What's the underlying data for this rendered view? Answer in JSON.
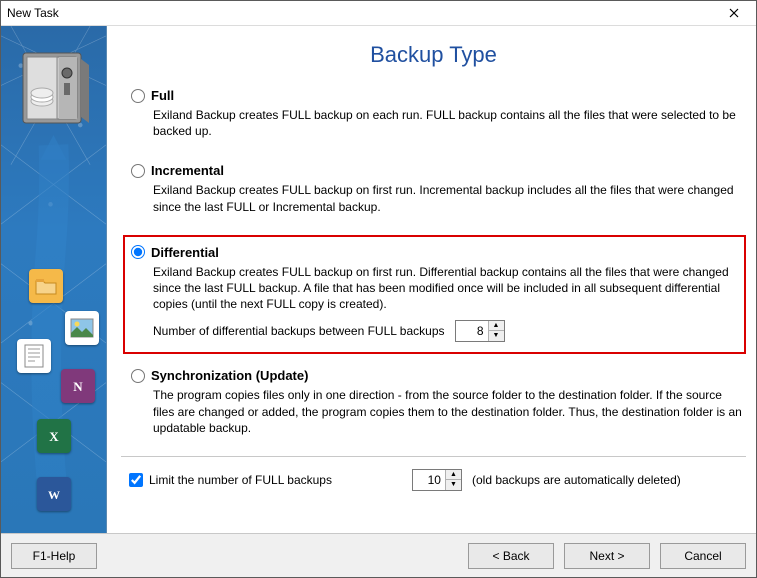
{
  "window": {
    "title": "New Task"
  },
  "heading": "Backup Type",
  "options": {
    "full": {
      "label": "Full",
      "desc": "Exiland Backup creates FULL backup on each run. FULL backup contains all the files that were selected to be backed up."
    },
    "incremental": {
      "label": "Incremental",
      "desc": "Exiland Backup creates FULL backup on first run. Incremental backup includes all the files that were changed since the last FULL or Incremental backup."
    },
    "differential": {
      "label": "Differential",
      "desc": "Exiland Backup creates FULL backup on first run. Differential backup contains all the files that were changed since the last FULL backup. A file that has been modified once will be included in all subsequent differential copies (until the next FULL copy is created).",
      "num_label": "Number of differential backups between FULL backups",
      "num_value": "8"
    },
    "sync": {
      "label": "Synchronization (Update)",
      "desc": "The program copies files only in one direction - from the source folder to the destination folder. If the source files are changed or added, the program copies them to the destination folder. Thus, the destination folder is an updatable backup."
    }
  },
  "limit": {
    "checkbox_label": "Limit the number of FULL backups",
    "checked": true,
    "value": "10",
    "suffix": "(old backups are automatically deleted)"
  },
  "selected": "differential",
  "footer": {
    "help": "F1-Help",
    "back": "< Back",
    "next": "Next >",
    "cancel": "Cancel"
  }
}
